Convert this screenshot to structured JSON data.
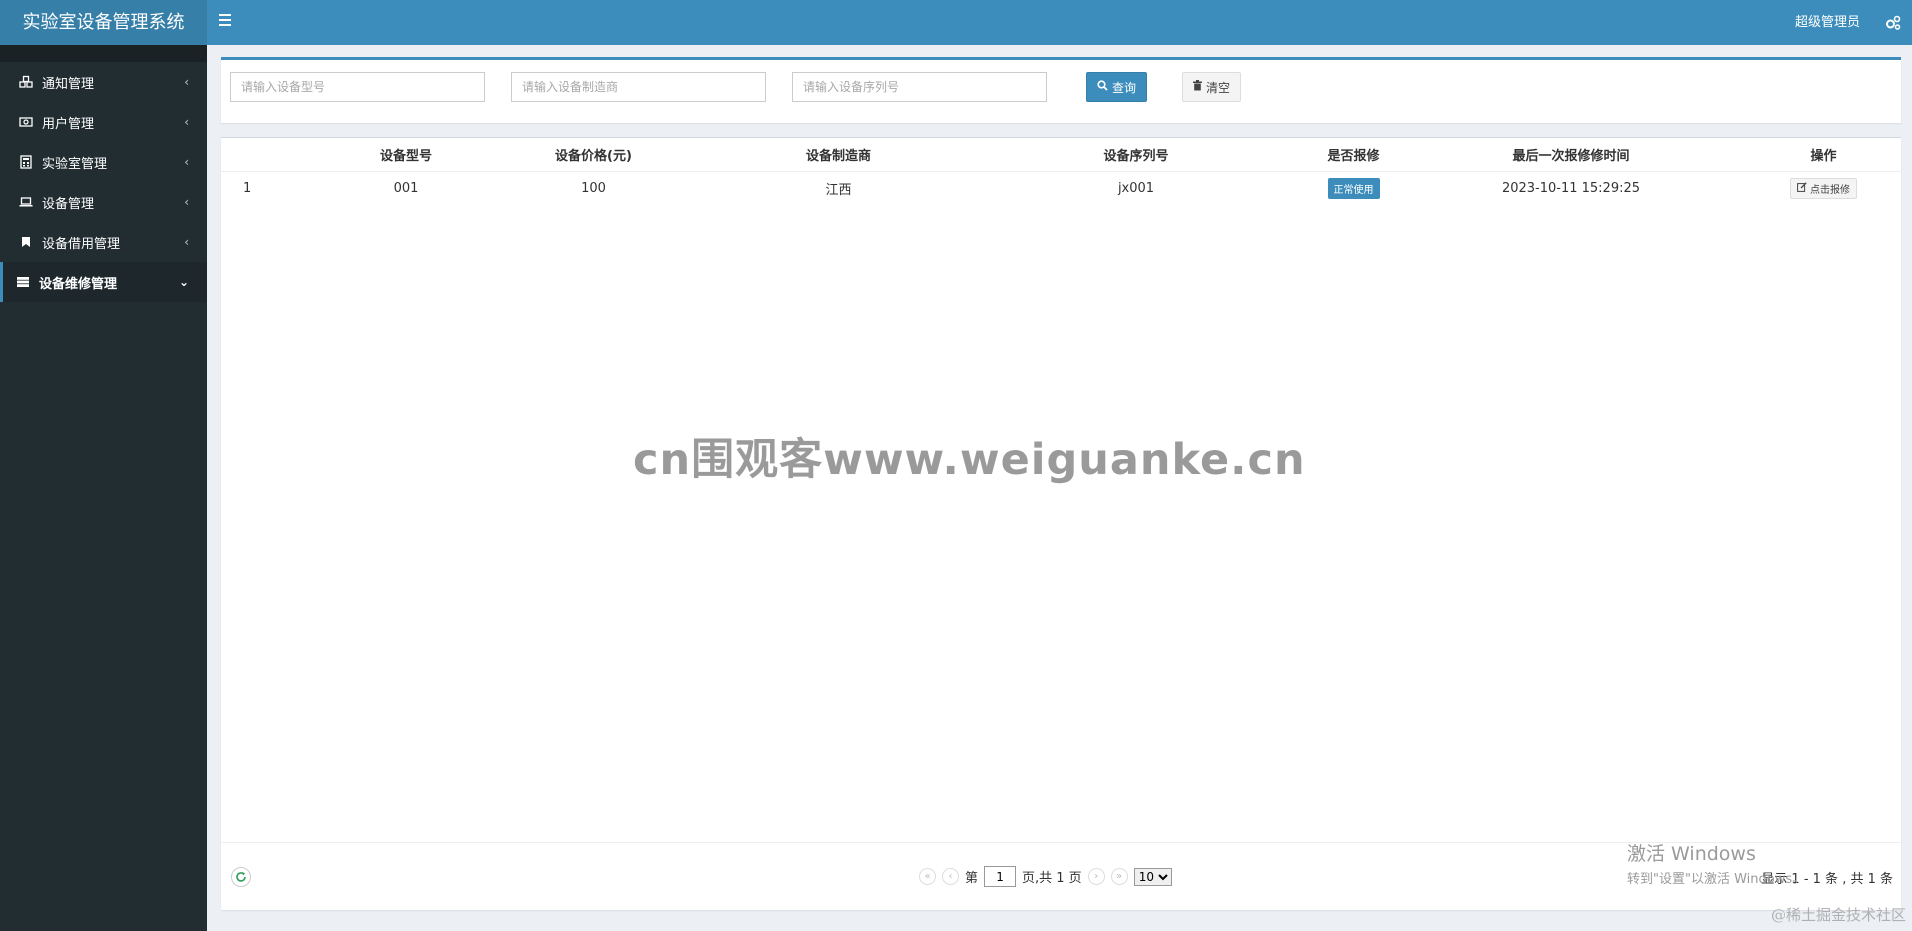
{
  "app": {
    "title": "实验室设备管理系统"
  },
  "header": {
    "user": "超级管理员"
  },
  "sidebar": {
    "items": [
      {
        "label": "通知管理",
        "icon": "cubes-icon"
      },
      {
        "label": "用户管理",
        "icon": "money-icon"
      },
      {
        "label": "实验室管理",
        "icon": "calculator-icon"
      },
      {
        "label": "设备管理",
        "icon": "laptop-icon"
      },
      {
        "label": "设备借用管理",
        "icon": "bookmark-icon"
      },
      {
        "label": "设备维修管理",
        "icon": "server-icon"
      }
    ]
  },
  "search": {
    "model_placeholder": "请输入设备型号",
    "maker_placeholder": "请输入设备制造商",
    "serial_placeholder": "请输入设备序列号",
    "query_label": "查询",
    "clear_label": "清空"
  },
  "table": {
    "headers": [
      "",
      "设备型号",
      "设备价格(元)",
      "设备制造商",
      "设备序列号",
      "是否报修",
      "最后一次报修修时间",
      "操作"
    ],
    "rows": [
      {
        "index": "1",
        "model": "001",
        "price": "100",
        "maker": "江西",
        "serial": "jx001",
        "status": "正常使用",
        "last_repair": "2023-10-11 15:29:25",
        "action": "点击报修"
      }
    ]
  },
  "pagination": {
    "prefix": "第",
    "current": "1",
    "suffix": "页,共 1 页",
    "page_size": "10",
    "info": "显示 1 - 1 条 , 共 1 条"
  },
  "watermark": "cn围观客www.weiguanke.cn",
  "windows_activation": {
    "line1": "激活 Windows",
    "line2": "转到\"设置\"以激活 Windows。"
  },
  "corner_watermark": "@稀土掘金技术社区",
  "colors": {
    "header": "#3c8dbc",
    "logo": "#367fa9",
    "sidebar": "#222d32",
    "badge": "#3c8dbc"
  }
}
